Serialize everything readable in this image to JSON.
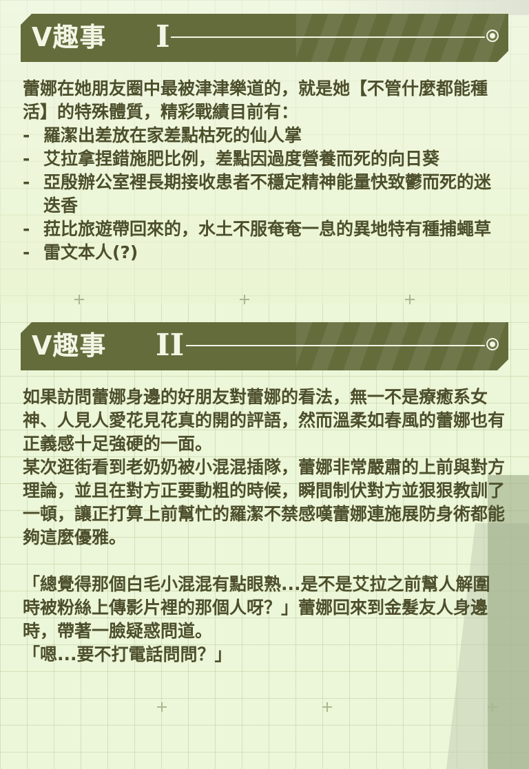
{
  "section1": {
    "title": "V趣事",
    "numeral": "I",
    "intro": "蕾娜在她朋友圈中最被津津樂道的，就是她【不管什麼都能種活】的特殊體質，精彩戰績目前有：",
    "bullets": [
      "羅潔出差放在家差點枯死的仙人掌",
      "艾拉拿捏錯施肥比例，差點因過度營養而死的向日葵",
      "亞殷辦公室裡長期接收患者不穩定精神能量快致鬱而死的迷迭香",
      "菈比旅遊帶回來的，水土不服奄奄一息的異地特有種捕蠅草",
      "雷文本人(?)"
    ]
  },
  "section2": {
    "title": "V趣事",
    "numeral": "II",
    "paragraphs": [
      "如果訪問蕾娜身邊的好朋友對蕾娜的看法，無一不是療癒系女神、人見人愛花見花真的開的評語，然而溫柔如春風的蕾娜也有正義感十足強硬的一面。",
      "某次逛街看到老奶奶被小混混插隊，蕾娜非常嚴肅的上前與對方理論，並且在對方正要動粗的時候，瞬間制伏對方並狠狠教訓了一頓，讓正打算上前幫忙的羅潔不禁感嘆蕾娜連施展防身術都能夠這麼優雅。",
      "「總覺得那個白毛小混混有點眼熟...是不是艾拉之前幫人解圍時被粉絲上傳影片裡的那個人呀？」蕾娜回來到金髮友人身邊時，帶著一臉疑惑問道。",
      "「嗯...要不打電話問問？」"
    ]
  },
  "colors": {
    "banner": "#646c3c",
    "text": "#4d4f2c",
    "background": "#ecf6d8"
  }
}
